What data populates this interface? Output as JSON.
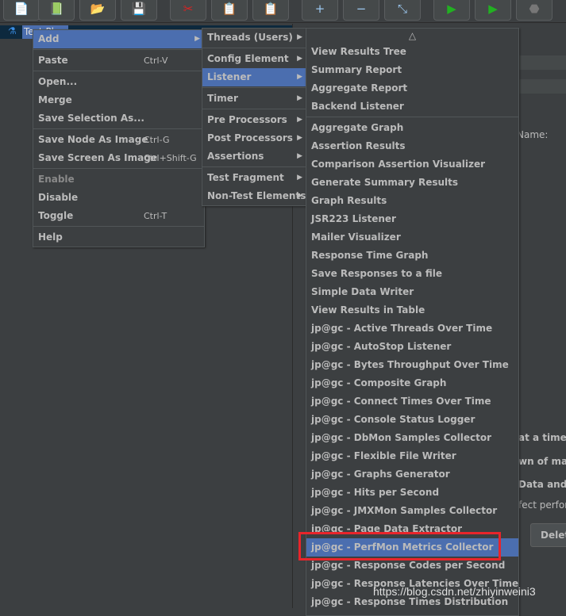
{
  "toolbar": {
    "buttons": [
      {
        "icon": "new-icon",
        "glyph": "📄"
      },
      {
        "icon": "templates-icon",
        "glyph": "📗"
      },
      {
        "icon": "open-icon",
        "glyph": "📂"
      },
      {
        "icon": "save-icon",
        "glyph": "💾"
      },
      {
        "icon": "cut-icon",
        "glyph": "✂"
      },
      {
        "icon": "copy-icon",
        "glyph": "📋"
      },
      {
        "icon": "paste-icon",
        "glyph": "📋"
      },
      {
        "icon": "expand-icon",
        "glyph": "+"
      },
      {
        "icon": "collapse-icon",
        "glyph": "−"
      },
      {
        "icon": "toggle-icon",
        "glyph": "⤡"
      },
      {
        "icon": "start-icon",
        "glyph": "▶"
      },
      {
        "icon": "start-no-pause-icon",
        "glyph": "▶"
      },
      {
        "icon": "stop-icon",
        "glyph": "⬣"
      }
    ]
  },
  "tree": {
    "selected_node": "Test Pl"
  },
  "context_menu": {
    "items": [
      {
        "label": "Add",
        "submenu": true,
        "selected": true
      },
      {
        "sep": true
      },
      {
        "label": "Paste",
        "shortcut": "Ctrl-V"
      },
      {
        "sep": true
      },
      {
        "label": "Open..."
      },
      {
        "label": "Merge"
      },
      {
        "label": "Save Selection As..."
      },
      {
        "sep": true
      },
      {
        "label": "Save Node As Image",
        "shortcut": "Ctrl-G"
      },
      {
        "label": "Save Screen As Image",
        "shortcut": "Ctrl+Shift-G"
      },
      {
        "sep": true
      },
      {
        "label": "Enable",
        "disabled": true
      },
      {
        "label": "Disable"
      },
      {
        "label": "Toggle",
        "shortcut": "Ctrl-T"
      },
      {
        "sep": true
      },
      {
        "label": "Help"
      }
    ]
  },
  "add_menu": {
    "items": [
      {
        "label": "Threads (Users)",
        "submenu": true
      },
      {
        "sep": true
      },
      {
        "label": "Config Element",
        "submenu": true
      },
      {
        "label": "Listener",
        "submenu": true,
        "selected": true
      },
      {
        "sep": true
      },
      {
        "label": "Timer",
        "submenu": true
      },
      {
        "sep": true
      },
      {
        "label": "Pre Processors",
        "submenu": true
      },
      {
        "label": "Post Processors",
        "submenu": true
      },
      {
        "label": "Assertions",
        "submenu": true
      },
      {
        "sep": true
      },
      {
        "label": "Test Fragment",
        "submenu": true
      },
      {
        "label": "Non-Test Elements",
        "submenu": true
      }
    ]
  },
  "listener_menu": {
    "scroll_up": "△",
    "items": [
      {
        "label": "View Results Tree"
      },
      {
        "label": "Summary Report"
      },
      {
        "label": "Aggregate Report"
      },
      {
        "label": "Backend Listener"
      },
      {
        "sep": true
      },
      {
        "label": "Aggregate Graph"
      },
      {
        "label": "Assertion Results"
      },
      {
        "label": "Comparison Assertion Visualizer"
      },
      {
        "label": "Generate Summary Results"
      },
      {
        "label": "Graph Results"
      },
      {
        "label": "JSR223 Listener"
      },
      {
        "label": "Mailer Visualizer"
      },
      {
        "label": "Response Time Graph"
      },
      {
        "label": "Save Responses to a file"
      },
      {
        "label": "Simple Data Writer"
      },
      {
        "label": "View Results in Table"
      },
      {
        "label": "jp@gc - Active Threads Over Time"
      },
      {
        "label": "jp@gc - AutoStop Listener"
      },
      {
        "label": "jp@gc - Bytes Throughput Over Time"
      },
      {
        "label": "jp@gc - Composite Graph"
      },
      {
        "label": "jp@gc - Connect Times Over Time"
      },
      {
        "label": "jp@gc - Console Status Logger"
      },
      {
        "label": "jp@gc - DbMon Samples Collector"
      },
      {
        "label": "jp@gc - Flexible File Writer"
      },
      {
        "label": "jp@gc - Graphs Generator"
      },
      {
        "label": "jp@gc - Hits per Second"
      },
      {
        "label": "jp@gc - JMXMon Samples Collector"
      },
      {
        "label": "jp@gc - Page Data Extractor"
      },
      {
        "label": "jp@gc - PerfMon Metrics Collector",
        "selected": true,
        "highlighted": true
      },
      {
        "label": "jp@gc - Response Codes per Second"
      },
      {
        "label": "jp@gc - Response Latencies Over Time"
      },
      {
        "label": "jp@gc - Response Times Distribution"
      }
    ]
  },
  "right_panel": {
    "name_label": "Name:",
    "text1": "at a time)",
    "text2": "wn of mai",
    "text3": "Data and S",
    "text4": "fect perforr",
    "delete_button": "Delete"
  },
  "watermark": "https://blog.csdn.net/zhiyinweini3",
  "colors": {
    "background": "#3c3f41",
    "selection": "#4b6eaf",
    "highlight_box": "#e8252b",
    "text": "#bbbbbb"
  }
}
